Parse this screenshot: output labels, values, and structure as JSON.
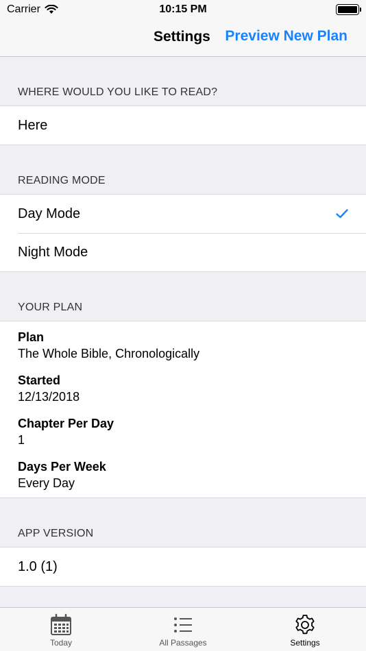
{
  "status_bar": {
    "carrier": "Carrier",
    "time": "10:15 PM"
  },
  "nav": {
    "title": "Settings",
    "action": "Preview New Plan"
  },
  "sections": {
    "location": {
      "header": "WHERE WOULD YOU LIKE TO READ?",
      "value": "Here"
    },
    "reading_mode": {
      "header": "READING MODE",
      "options": [
        {
          "label": "Day Mode",
          "selected": true
        },
        {
          "label": "Night Mode",
          "selected": false
        }
      ]
    },
    "plan": {
      "header": "YOUR PLAN",
      "items": [
        {
          "label": "Plan",
          "value": "The Whole Bible, Chronologically"
        },
        {
          "label": "Started",
          "value": "12/13/2018"
        },
        {
          "label": "Chapter Per Day",
          "value": "1"
        },
        {
          "label": "Days Per Week",
          "value": "Every Day"
        }
      ]
    },
    "app_version": {
      "header": "APP VERSION",
      "value": "1.0 (1)"
    }
  },
  "tab_bar": {
    "tabs": [
      {
        "label": "Today",
        "icon": "calendar-icon"
      },
      {
        "label": "All Passages",
        "icon": "list-icon"
      },
      {
        "label": "Settings",
        "icon": "gear-icon",
        "active": true
      }
    ]
  },
  "colors": {
    "accent": "#1a82fb",
    "background": "#efeff4"
  }
}
